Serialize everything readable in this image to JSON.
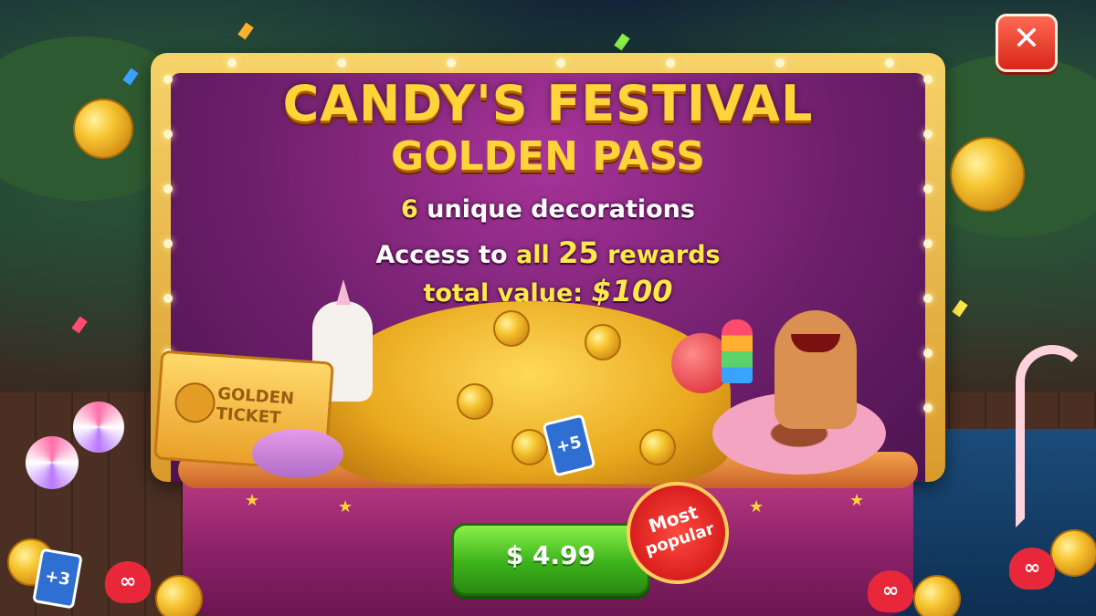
{
  "title": {
    "line1": "CANDY'S FESTIVAL",
    "line2": "GOLDEN PASS"
  },
  "features": {
    "decorations_count": "6",
    "decorations_text": "unique decorations",
    "access_prefix": "Access to",
    "access_all": "all",
    "access_count": "25",
    "access_suffix": "rewards",
    "value_label": "total value:",
    "value_amount": "$100"
  },
  "ticket": {
    "line1": "GOLDEN",
    "line2": "TICKET"
  },
  "cards": {
    "plus5": "+5",
    "plus3": "+3"
  },
  "purchase": {
    "price_label": "$ 4.99"
  },
  "badge": {
    "line1": "Most",
    "line2": "popular"
  },
  "close": {
    "icon": "close-icon",
    "glyph": "✕"
  },
  "colors": {
    "title": "#ffd43b",
    "panel": "#6e1f6b",
    "buy_button": "#3cb21a",
    "badge": "#d81f1f",
    "close_button": "#d8261a"
  }
}
